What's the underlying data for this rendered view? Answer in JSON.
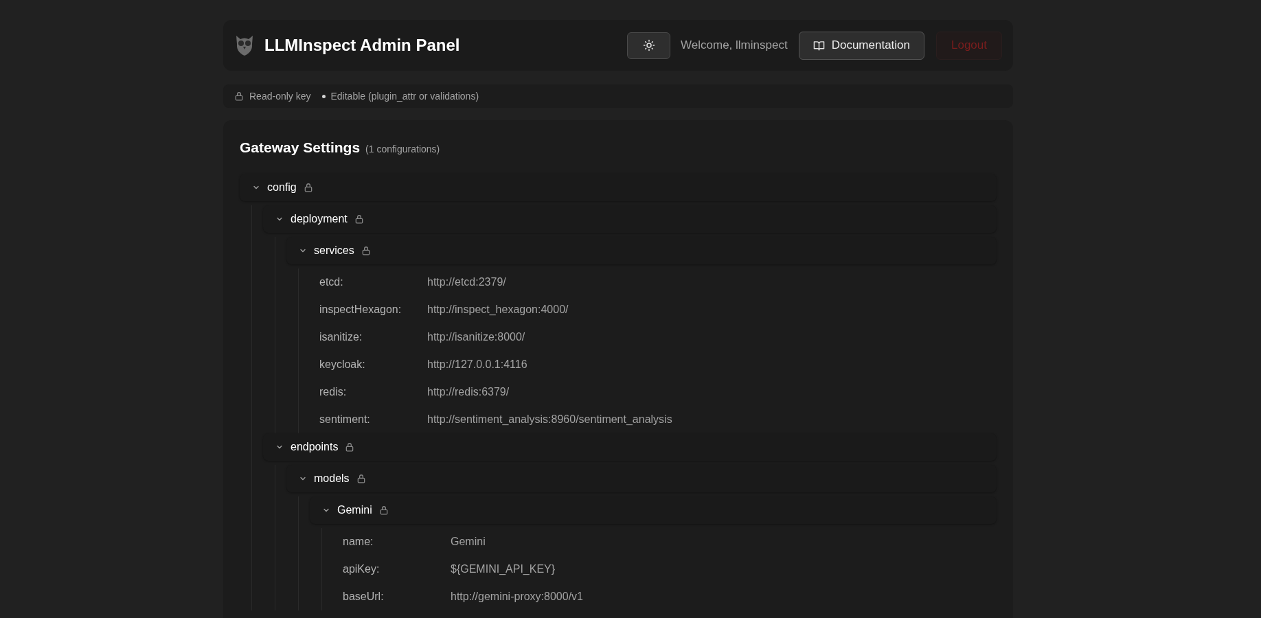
{
  "header": {
    "title": "LLMInspect Admin Panel",
    "welcome": "Welcome, llminspect",
    "documentation": "Documentation",
    "logout": "Logout"
  },
  "legend": [
    {
      "kind": "lock",
      "label": "Read-only key"
    },
    {
      "kind": "dot",
      "label": "Editable (plugin_attr or validations)"
    }
  ],
  "panel": {
    "title": "Gateway Settings",
    "count": "(1 configurations)",
    "tree": [
      {
        "kind": "node",
        "key": "config",
        "locked": true,
        "expanded": true,
        "children": [
          {
            "kind": "node",
            "key": "deployment",
            "locked": true,
            "expanded": true,
            "children": [
              {
                "kind": "node",
                "key": "services",
                "locked": true,
                "expanded": true,
                "children": [
                  {
                    "kind": "leaf",
                    "key": "etcd:",
                    "value": "http://etcd:2379/"
                  },
                  {
                    "kind": "leaf",
                    "key": "inspectHexagon:",
                    "value": "http://inspect_hexagon:4000/"
                  },
                  {
                    "kind": "leaf",
                    "key": "isanitize:",
                    "value": "http://isanitize:8000/"
                  },
                  {
                    "kind": "leaf",
                    "key": "keycloak:",
                    "value": "http://127.0.0.1:4116"
                  },
                  {
                    "kind": "leaf",
                    "key": "redis:",
                    "value": "http://redis:6379/"
                  },
                  {
                    "kind": "leaf",
                    "key": "sentiment:",
                    "value": "http://sentiment_analysis:8960/sentiment_analysis"
                  }
                ]
              }
            ]
          },
          {
            "kind": "node",
            "key": "endpoints",
            "locked": true,
            "expanded": true,
            "children": [
              {
                "kind": "node",
                "key": "models",
                "locked": true,
                "expanded": true,
                "children": [
                  {
                    "kind": "node",
                    "key": "Gemini",
                    "locked": true,
                    "expanded": true,
                    "children": [
                      {
                        "kind": "leaf",
                        "key": "name:",
                        "value": "Gemini"
                      },
                      {
                        "kind": "leaf",
                        "key": "apiKey:",
                        "value": "${GEMINI_API_KEY}"
                      },
                      {
                        "kind": "leaf",
                        "key": "baseUrl:",
                        "value": "http://gemini-proxy:8000/v1"
                      }
                    ]
                  }
                ]
              }
            ]
          }
        ]
      }
    ]
  }
}
